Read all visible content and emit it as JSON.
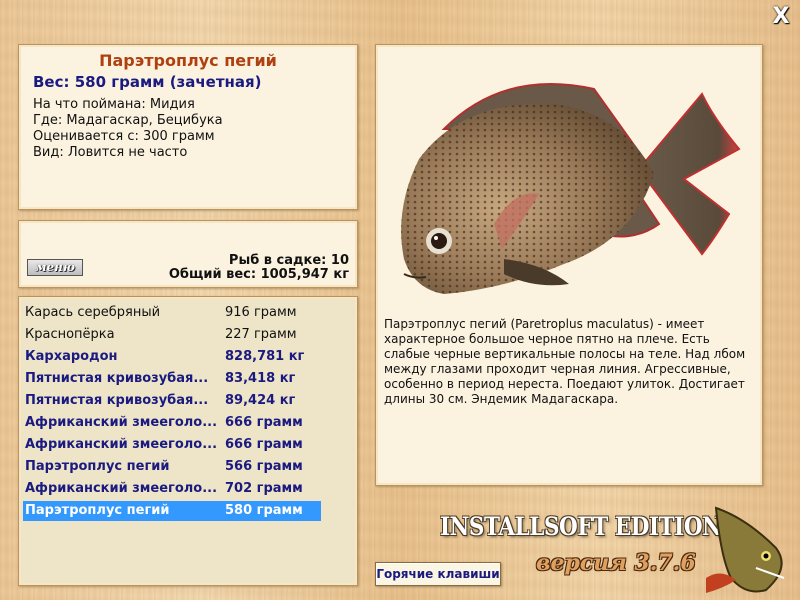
{
  "window": {
    "close_label": "X"
  },
  "info": {
    "title": "Парэтроплус пегий",
    "weight": "Вес: 580 грамм (зачетная)",
    "lines": [
      "На что поймана: Мидия",
      "Где: Мадагаскар, Бецибука",
      "Оценивается с: 300 грамм",
      "Вид: Ловится не часто"
    ]
  },
  "stats": {
    "menu_label": "меню",
    "fish_in_net": "Рыб в садке: 10",
    "total_weight": "Общий вес: 1005,947 кг"
  },
  "catch_list": [
    {
      "name": "Карась серебряный",
      "weight": "916 грамм",
      "style": "normal"
    },
    {
      "name": "Краснопёрка",
      "weight": "227 грамм",
      "style": "normal"
    },
    {
      "name": "Кархародон",
      "weight": "828,781 кг",
      "style": "hl"
    },
    {
      "name": "Пятнистая кривозубая...",
      "weight": "83,418 кг",
      "style": "hl"
    },
    {
      "name": "Пятнистая кривозубая...",
      "weight": "89,424 кг",
      "style": "hl"
    },
    {
      "name": "Африканский змееголо...",
      "weight": "666 грамм",
      "style": "hl"
    },
    {
      "name": "Африканский змееголо...",
      "weight": "666 грамм",
      "style": "hl"
    },
    {
      "name": "Парэтроплус пегий",
      "weight": "566 грамм",
      "style": "hl"
    },
    {
      "name": "Африканский змееголо...",
      "weight": "702 грамм",
      "style": "hl"
    },
    {
      "name": "Парэтроплус пегий",
      "weight": "580 грамм",
      "style": "sel"
    }
  ],
  "description": "Парэтроплус пегий (Paretroplus maculatus) - имеет характерное большое черное пятно на плече. Есть слабые черные вертикальные полосы на теле. Над лбом между глазами проходит черная линия. Агрессивные, особенно в период нереста. Поедают улиток. Достигает длины 30 см. Эндемик Мадагаскара.",
  "hotkeys_label": "Горячие клавиши",
  "logo": {
    "title": "INSTALLSOFT EDITION",
    "version": "версия 3.7.6"
  },
  "colors": {
    "title_accent": "#b0400f",
    "highlight_text": "#1a1a80",
    "selection": "#3399ff",
    "panel_bg": "#fbf3e0",
    "list_bg": "#eee5c8"
  }
}
